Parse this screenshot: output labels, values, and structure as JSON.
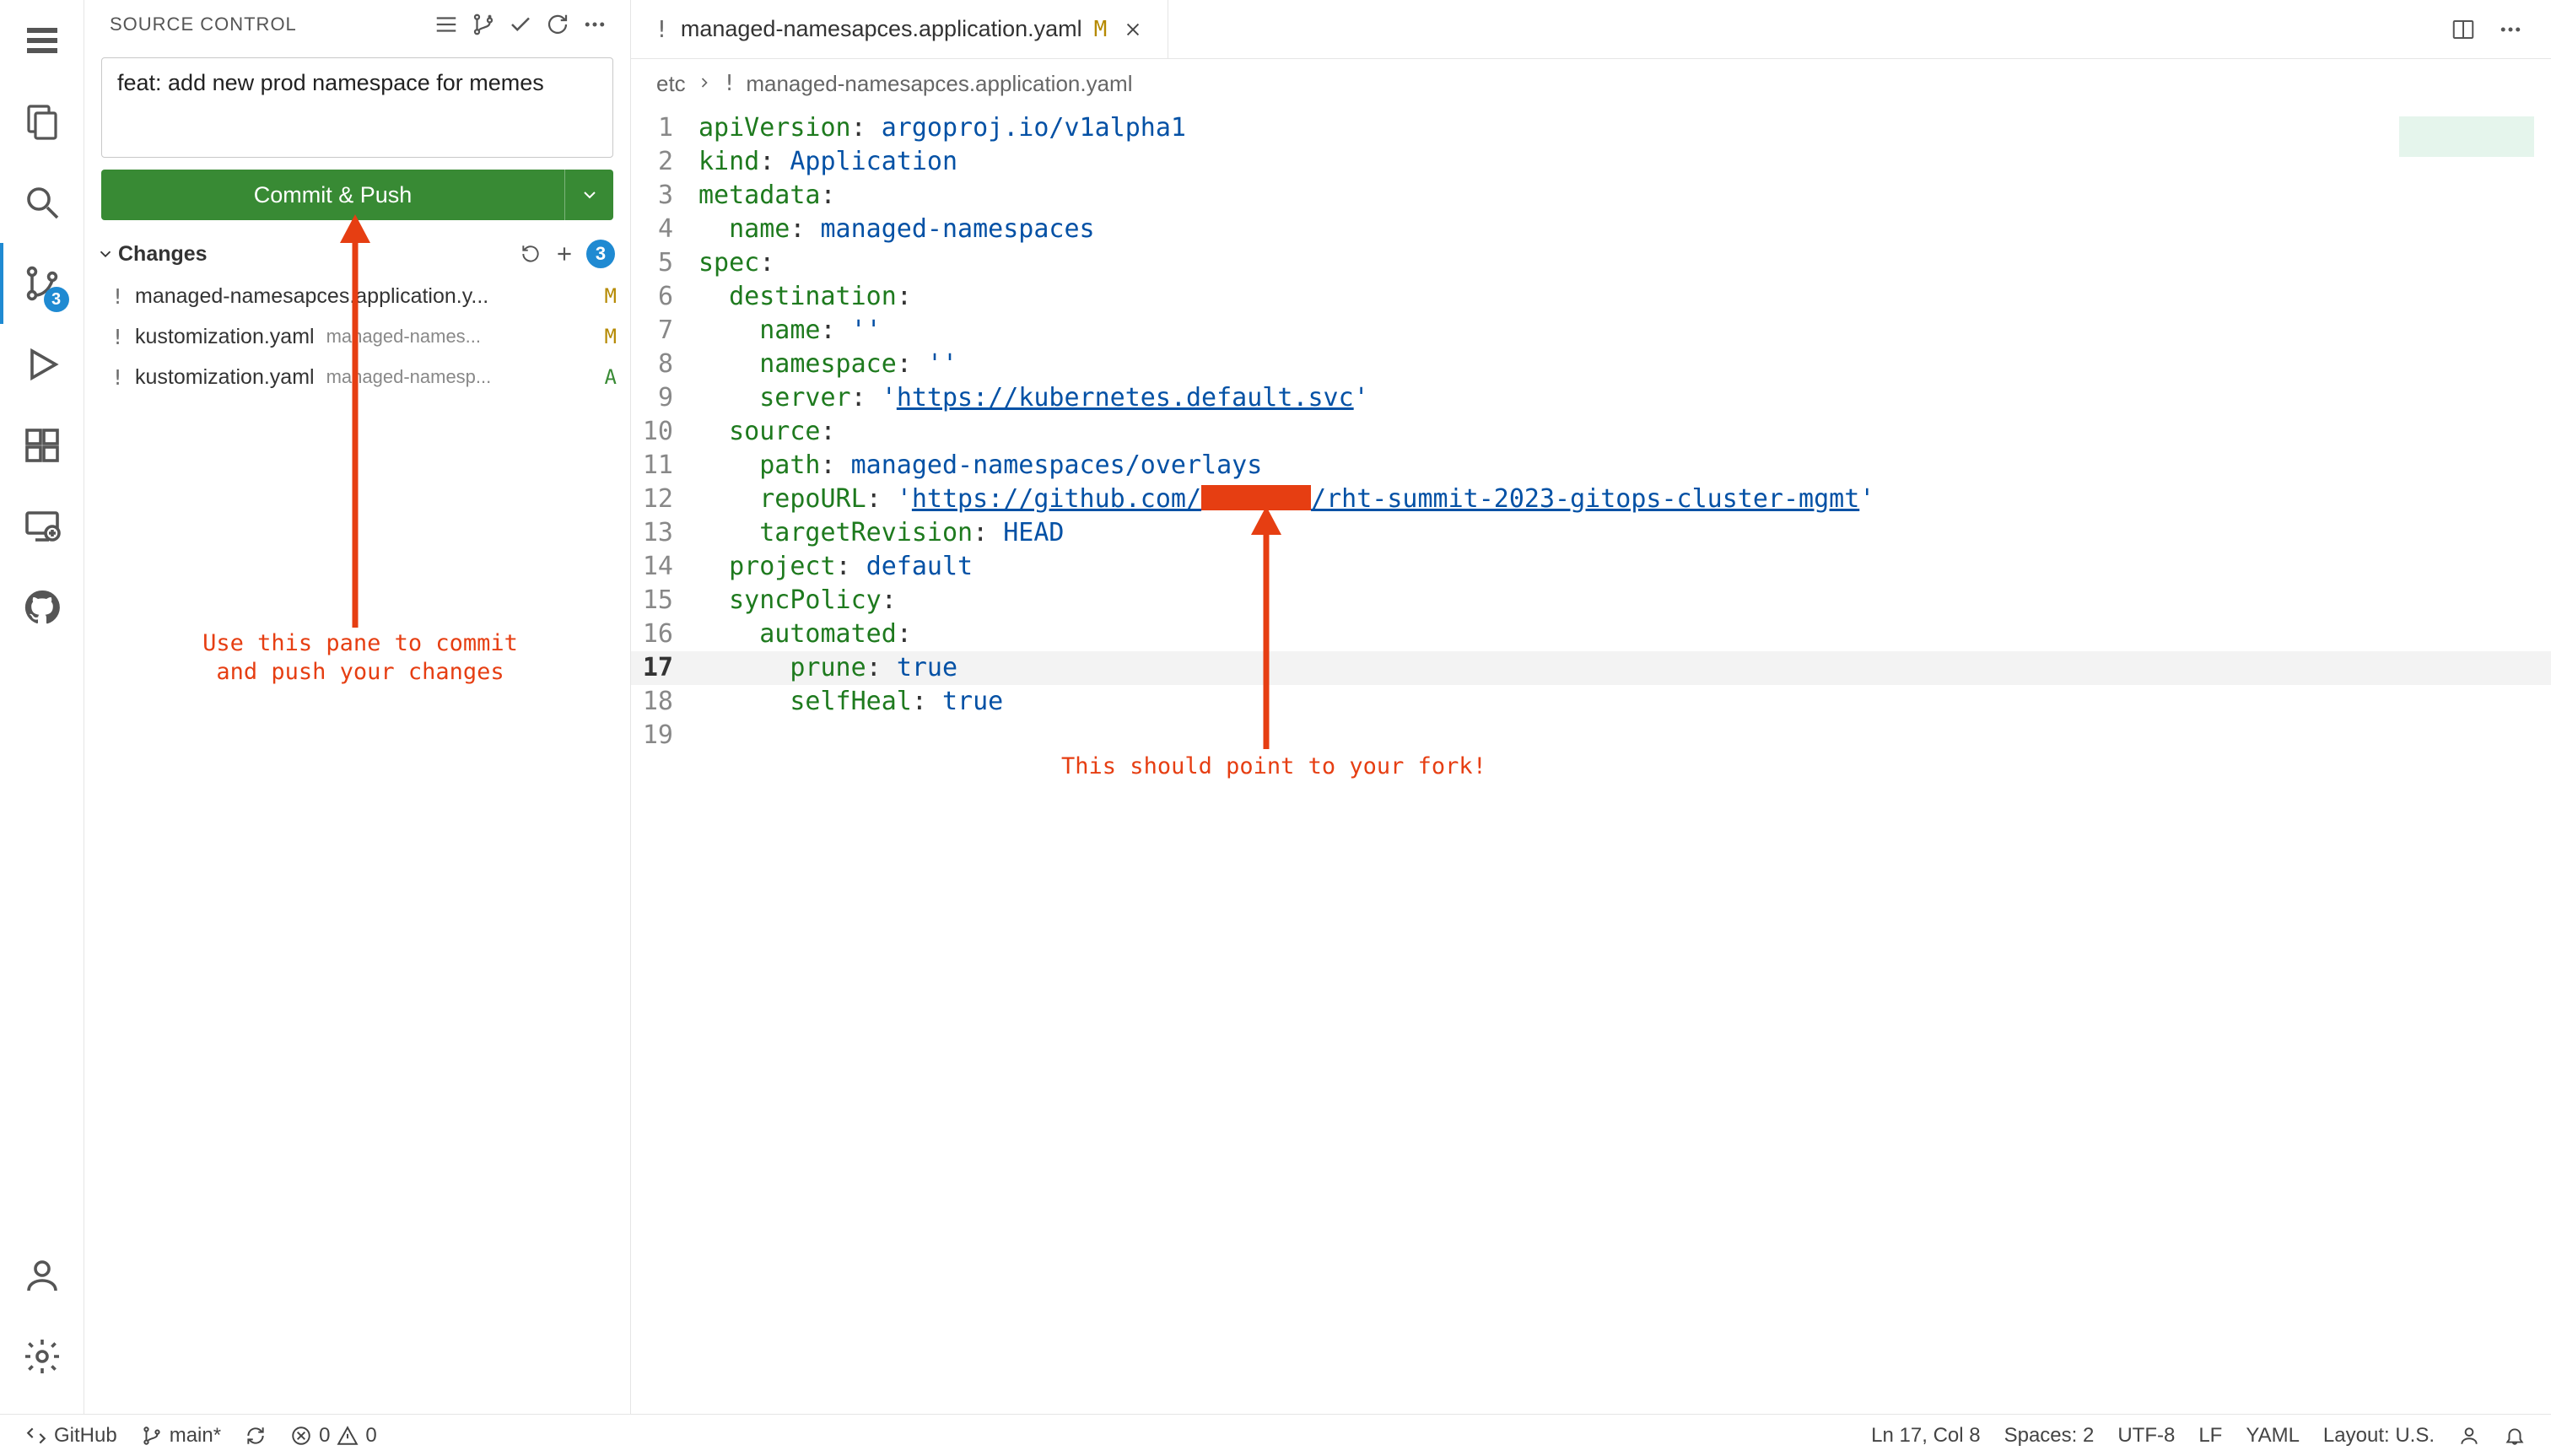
{
  "activity": {
    "scm_badge": "3"
  },
  "sidebar": {
    "title": "SOURCE CONTROL",
    "commit_message": "feat: add new prod namespace for memes",
    "commit_button": "Commit & Push",
    "changes_label": "Changes",
    "changes_count": "3",
    "items": [
      {
        "name": "managed-namesapces.application.y...",
        "path": "",
        "status": "M"
      },
      {
        "name": "kustomization.yaml",
        "path": "managed-names...",
        "status": "M"
      },
      {
        "name": "kustomization.yaml",
        "path": "managed-namesp...",
        "status": "A"
      }
    ]
  },
  "tab": {
    "name": "managed-namesapces.application.yaml",
    "status": "M"
  },
  "breadcrumb": {
    "root": "etc",
    "file": "managed-namesapces.application.yaml"
  },
  "code": {
    "lines": [
      [
        {
          "c": "tok-key",
          "t": "apiVersion"
        },
        {
          "c": "tok-punc",
          "t": ": "
        },
        {
          "c": "tok-str",
          "t": "argoproj.io/v1alpha1"
        }
      ],
      [
        {
          "c": "tok-key",
          "t": "kind"
        },
        {
          "c": "tok-punc",
          "t": ": "
        },
        {
          "c": "tok-str",
          "t": "Application"
        }
      ],
      [
        {
          "c": "tok-key",
          "t": "metadata"
        },
        {
          "c": "tok-punc",
          "t": ":"
        }
      ],
      [
        {
          "c": "",
          "t": "  "
        },
        {
          "c": "tok-key",
          "t": "name"
        },
        {
          "c": "tok-punc",
          "t": ": "
        },
        {
          "c": "tok-str",
          "t": "managed-namespaces"
        }
      ],
      [
        {
          "c": "tok-key",
          "t": "spec"
        },
        {
          "c": "tok-punc",
          "t": ":"
        }
      ],
      [
        {
          "c": "",
          "t": "  "
        },
        {
          "c": "tok-key",
          "t": "destination"
        },
        {
          "c": "tok-punc",
          "t": ":"
        }
      ],
      [
        {
          "c": "",
          "t": "    "
        },
        {
          "c": "tok-key",
          "t": "name"
        },
        {
          "c": "tok-punc",
          "t": ": "
        },
        {
          "c": "tok-str",
          "t": "''"
        }
      ],
      [
        {
          "c": "",
          "t": "    "
        },
        {
          "c": "tok-key",
          "t": "namespace"
        },
        {
          "c": "tok-punc",
          "t": ": "
        },
        {
          "c": "tok-str",
          "t": "''"
        }
      ],
      [
        {
          "c": "",
          "t": "    "
        },
        {
          "c": "tok-key",
          "t": "server"
        },
        {
          "c": "tok-punc",
          "t": ": "
        },
        {
          "c": "tok-str",
          "t": "'"
        },
        {
          "c": "tok-url",
          "t": "https://kubernetes.default.svc"
        },
        {
          "c": "tok-str",
          "t": "'"
        }
      ],
      [
        {
          "c": "",
          "t": "  "
        },
        {
          "c": "tok-key",
          "t": "source"
        },
        {
          "c": "tok-punc",
          "t": ":"
        }
      ],
      [
        {
          "c": "",
          "t": "    "
        },
        {
          "c": "tok-key",
          "t": "path"
        },
        {
          "c": "tok-punc",
          "t": ": "
        },
        {
          "c": "tok-str",
          "t": "managed-namespaces/overlays"
        }
      ],
      [
        {
          "c": "",
          "t": "    "
        },
        {
          "c": "tok-key",
          "t": "repoURL"
        },
        {
          "c": "tok-punc",
          "t": ": "
        },
        {
          "c": "tok-str",
          "t": "'"
        },
        {
          "c": "tok-url",
          "t": "https://github.com/"
        },
        {
          "c": "redacted",
          "t": ""
        },
        {
          "c": "tok-url",
          "t": "/rht-summit-2023-gitops-cluster-mgmt"
        },
        {
          "c": "tok-str",
          "t": "'"
        }
      ],
      [
        {
          "c": "",
          "t": "    "
        },
        {
          "c": "tok-key",
          "t": "targetRevision"
        },
        {
          "c": "tok-punc",
          "t": ": "
        },
        {
          "c": "tok-str",
          "t": "HEAD"
        }
      ],
      [
        {
          "c": "",
          "t": "  "
        },
        {
          "c": "tok-key",
          "t": "project"
        },
        {
          "c": "tok-punc",
          "t": ": "
        },
        {
          "c": "tok-str",
          "t": "default"
        }
      ],
      [
        {
          "c": "",
          "t": "  "
        },
        {
          "c": "tok-key",
          "t": "syncPolicy"
        },
        {
          "c": "tok-punc",
          "t": ":"
        }
      ],
      [
        {
          "c": "",
          "t": "    "
        },
        {
          "c": "tok-key",
          "t": "automated"
        },
        {
          "c": "tok-punc",
          "t": ":"
        }
      ],
      [
        {
          "c": "",
          "t": "      "
        },
        {
          "c": "tok-key",
          "t": "prune"
        },
        {
          "c": "tok-punc",
          "t": ": "
        },
        {
          "c": "tok-str",
          "t": "true"
        }
      ],
      [
        {
          "c": "",
          "t": "      "
        },
        {
          "c": "tok-key",
          "t": "selfHeal"
        },
        {
          "c": "tok-punc",
          "t": ": "
        },
        {
          "c": "tok-str",
          "t": "true"
        }
      ],
      []
    ],
    "highlight_line": 17
  },
  "annotations": {
    "left_text": "Use this pane to commit\nand push your changes",
    "right_text": "This should point to your fork!"
  },
  "status": {
    "remote": "GitHub",
    "branch": "main*",
    "errors": "0",
    "warnings": "0",
    "cursor": "Ln 17, Col 8",
    "spaces": "Spaces: 2",
    "encoding": "UTF-8",
    "eol": "LF",
    "language": "YAML",
    "layout": "Layout: U.S."
  }
}
